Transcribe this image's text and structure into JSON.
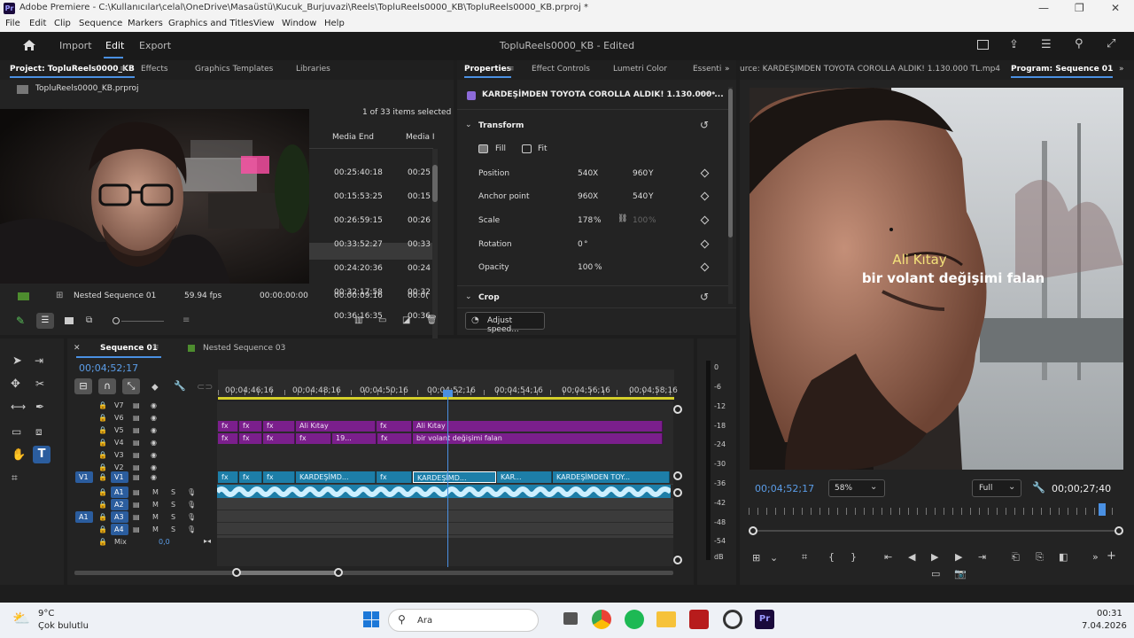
{
  "window": {
    "title": "Adobe Premiere - C:\\Kullanıcılar\\celal\\OneDrive\\Masaüstü\\Kucuk_Burjuvazi\\Reels\\TopluReels0000_KB\\TopluReels0000_KB.prproj *",
    "app_icon": "Pr"
  },
  "menu": [
    "File",
    "Edit",
    "Clip",
    "Sequence",
    "Markers",
    "Graphics and Titles",
    "View",
    "Window",
    "Help"
  ],
  "header": {
    "workspaces": [
      "Import",
      "Edit",
      "Export"
    ],
    "active_workspace": "Edit",
    "project_title": "TopluReels0000_KB - Edited"
  },
  "project_panel": {
    "tabs": [
      "Project: TopluReels0000_KB",
      "Effects",
      "Graphics Templates",
      "Libraries"
    ],
    "file": "TopluReels0000_KB.prproj",
    "item_count": "1 of 33 items selected",
    "columns": [
      "Media End",
      "Media I"
    ],
    "rows": [
      {
        "end": "00:25:40:18",
        "other": "00:25"
      },
      {
        "end": "00:15:53:25",
        "other": "00:15"
      },
      {
        "end": "00:26:59:15",
        "other": "00:26"
      },
      {
        "end": "00:33:52:27",
        "other": "00:33"
      },
      {
        "end": "00:24:20:36",
        "other": "00:24"
      },
      {
        "end": "00:32:17:58",
        "other": "00:32"
      },
      {
        "end": "00:36:16:35",
        "other": "00:36"
      },
      {
        "end": "00:00:09:16",
        "other": "00:0("
      }
    ],
    "nested_row": {
      "name": "Nested Sequence 01",
      "fps": "59.94 fps",
      "start": "00:00:00:00"
    }
  },
  "properties_panel": {
    "tabs": [
      "Properties",
      "Effect Controls",
      "Lumetri Color",
      "Essenti"
    ],
    "clip_name": "KARDEŞİMDEN TOYOTA COROLLA ALDIK! 1.130.000 ...",
    "transform_label": "Transform",
    "fill_label": "Fill",
    "fit_label": "Fit",
    "props": [
      {
        "label": "Position",
        "v1": "540",
        "u1": "X",
        "v2": "960",
        "u2": "Y"
      },
      {
        "label": "Anchor point",
        "v1": "960",
        "u1": "X",
        "v2": "540",
        "u2": "Y"
      },
      {
        "label": "Scale",
        "v1": "178",
        "u1": "%",
        "v2": "100",
        "u2": "%"
      },
      {
        "label": "Rotation",
        "v1": "0",
        "u1": "°",
        "v2": "",
        "u2": ""
      },
      {
        "label": "Opacity",
        "v1": "100",
        "u1": "%",
        "v2": "",
        "u2": ""
      }
    ],
    "crop_label": "Crop",
    "adjust_speed": "Adjust speed..."
  },
  "monitor": {
    "source_tab": "urce: KARDEŞİMDEN TOYOTA COROLLA ALDIK! 1.130.000 TL.mp4",
    "program_tab": "Program: Sequence 01",
    "caption_line1": "Ali Kıtay",
    "caption_line2": "bir volant değişimi falan",
    "timecode": "00;04;52;17",
    "zoom": "58%",
    "quality": "Full",
    "duration": "00;00;27;40",
    "playhead_fraction": 0.95
  },
  "timeline": {
    "tabs": [
      "Sequence 01",
      "Nested Sequence 03"
    ],
    "timecode": "00;04;52;17",
    "ruler": [
      "00;04;46;16",
      "00;04;48;16",
      "00;04;50;16",
      "00;04;52;16",
      "00;04;54;16",
      "00;04;56;16",
      "00;04;58;16"
    ],
    "video_tracks": [
      "V7",
      "V6",
      "V5",
      "V4",
      "V3",
      "V2",
      "V1"
    ],
    "audio_tracks": [
      "A1",
      "A2",
      "A3",
      "A4"
    ],
    "source_v": "V1",
    "source_a": "A1",
    "mix_label": "Mix",
    "mix_value": "0,0",
    "fx": "fx",
    "v5_clips": [
      "Ali Kıtay",
      "Ali Kıtay"
    ],
    "v4_clips": [
      "19...",
      "bir volant değişimi falan"
    ],
    "v1_clips": [
      "KARDEŞİMD...",
      "KARDEŞİMD...",
      "KAR...",
      "KARDEŞİMDEN TOY..."
    ],
    "meter_labels": [
      "0",
      "-6",
      "-12",
      "-18",
      "-24",
      "-30",
      "-36",
      "-42",
      "-48",
      "-54",
      "dB"
    ],
    "ms_m": "M",
    "ms_s": "S"
  },
  "taskbar": {
    "weather_temp": "9°C",
    "weather_desc": "Çok bulutlu",
    "search": "Ara",
    "time": "00:31",
    "date": "7.04.2026"
  }
}
